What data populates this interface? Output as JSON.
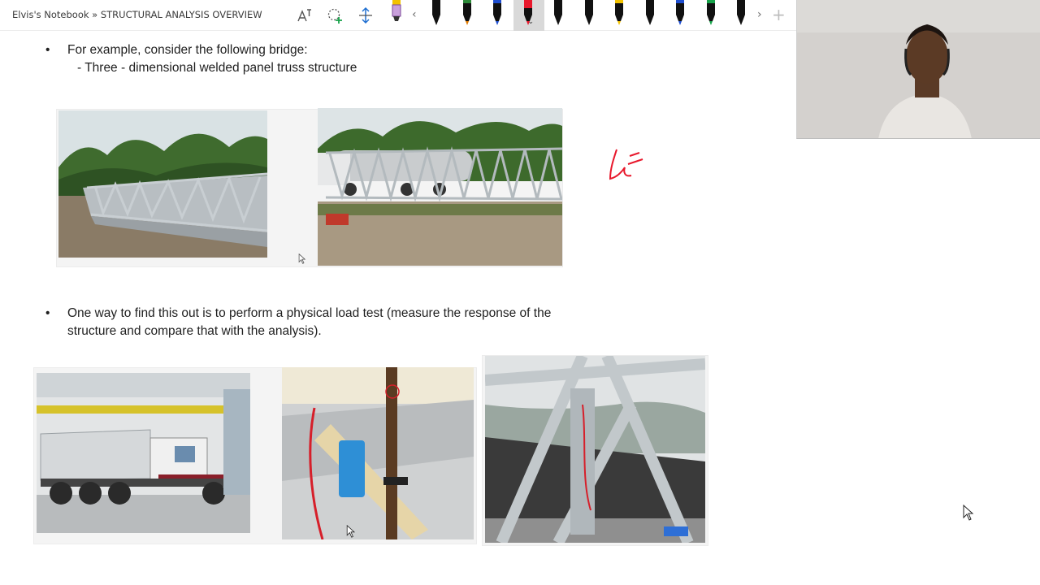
{
  "toolbar": {
    "breadcrumb": "Elvis's Notebook » STRUCTURAL ANALYSIS OVERVIEW",
    "pens": [
      {
        "name": "pen-highlighter-yellow",
        "color": "#f2c200",
        "cap": "#c9a0dc"
      },
      {
        "name": "pen-black-1",
        "color": "#111111",
        "cap": "#111111"
      },
      {
        "name": "pen-orange",
        "color": "#e07a00",
        "cap": "#2e8b3a"
      },
      {
        "name": "pen-blue-1",
        "color": "#1f4fd1",
        "cap": "#1f4fd1"
      },
      {
        "name": "pen-red-selected",
        "color": "#e8182c",
        "cap": "#e8182c"
      },
      {
        "name": "pen-black-2",
        "color": "#111111",
        "cap": "#111111"
      },
      {
        "name": "pen-black-3",
        "color": "#111111",
        "cap": "#111111"
      },
      {
        "name": "pen-yellow",
        "color": "#f2c200",
        "cap": "#f2c200"
      },
      {
        "name": "pen-black-4",
        "color": "#111111",
        "cap": "#111111"
      },
      {
        "name": "pen-blue-2",
        "color": "#1f4fd1",
        "cap": "#1f4fd1"
      },
      {
        "name": "pen-green",
        "color": "#17a34a",
        "cap": "#17a34a"
      },
      {
        "name": "pen-black-5",
        "color": "#111111",
        "cap": "#111111"
      }
    ],
    "accent_color": "#e8182c"
  },
  "content": {
    "bullet1_line1": "For example, consider the following bridge:",
    "bullet1_line2": "- Three - dimensional welded panel truss structure",
    "bullet2_line1": "One way to find this out is to perform a physical load test (measure the response of the",
    "bullet2_line2": "structure and compare that with the analysis).",
    "bullet_symbol": "•"
  }
}
